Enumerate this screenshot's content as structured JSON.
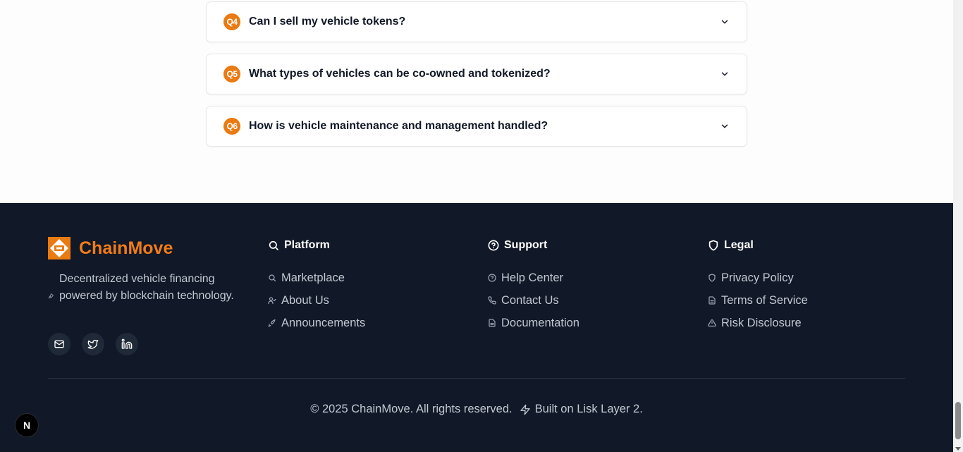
{
  "faq": {
    "items": [
      {
        "badge": "Q4",
        "question": "Can I sell my vehicle tokens?"
      },
      {
        "badge": "Q5",
        "question": "What types of vehicles can be co-owned and tokenized?"
      },
      {
        "badge": "Q6",
        "question": "How is vehicle maintenance and management handled?"
      }
    ]
  },
  "footer": {
    "brand": {
      "name": "ChainMove",
      "description": "Decentralized vehicle financing powered by blockchain technology."
    },
    "socials": [
      "mail-icon",
      "twitter-icon",
      "linkedin-icon"
    ],
    "columns": [
      {
        "title": "Platform",
        "icon": "search-icon",
        "links": [
          {
            "label": "Marketplace",
            "icon": "search-icon"
          },
          {
            "label": "About Us",
            "icon": "users-icon"
          },
          {
            "label": "Announcements",
            "icon": "rocket-icon"
          }
        ]
      },
      {
        "title": "Support",
        "icon": "help-circle-icon",
        "links": [
          {
            "label": "Help Center",
            "icon": "help-circle-icon"
          },
          {
            "label": "Contact Us",
            "icon": "phone-icon"
          },
          {
            "label": "Documentation",
            "icon": "file-icon"
          }
        ]
      },
      {
        "title": "Legal",
        "icon": "shield-icon",
        "links": [
          {
            "label": "Privacy Policy",
            "icon": "shield-icon"
          },
          {
            "label": "Terms of Service",
            "icon": "file-icon"
          },
          {
            "label": "Risk Disclosure",
            "icon": "alert-triangle-icon"
          }
        ]
      }
    ],
    "copyright": "© 2025 ChainMove. All rights reserved.",
    "built_on": "Built on Lisk Layer 2."
  },
  "dev_badge": {
    "label": "N"
  },
  "colors": {
    "accent": "#ea7a12",
    "footer_bg": "#111827",
    "footer_text": "#c2c8d2"
  }
}
